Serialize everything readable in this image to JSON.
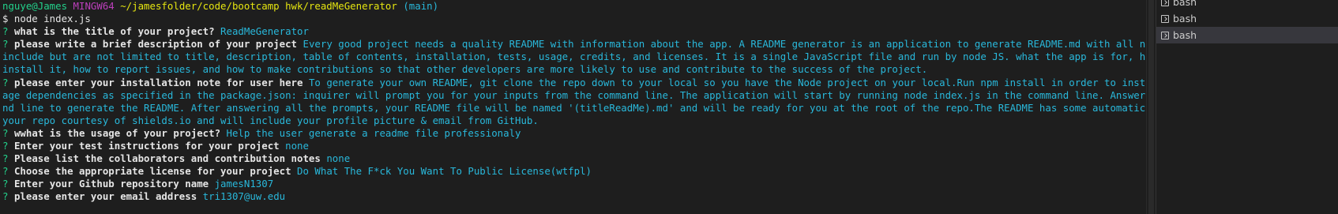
{
  "prompt": {
    "user": "nguye@James",
    "host": "MINGW64",
    "path": "~/jamesfolder/code/bootcamp hwk/readMeGenerator",
    "branch": "(main)",
    "command": "$ node index.js"
  },
  "qa": {
    "q1": "what is the title of your project?",
    "a1": "ReadMeGenerator",
    "q2": "please write a brief description of your project",
    "a2_l1": "Every good project needs a quality README with information about the app. A README generator is an application to generate README.md with all necessary components which",
    "a2_l2": "include but are not limited to title, description, table of contents, installation, tests, usage, credits, and licenses. It is a single JavaScript file and run by node JS. what the app is for, how to use the app, how to",
    "a2_l3": "install it, how to report issues, and how to make contributions so that other developers are more likely to use and contribute to the success of the project.",
    "q3": "please enter your installation note for user here",
    "a3_l1": "To generate your own README, git clone the repo down to your local so you have the Node project on your local.Run npm install in order to install the following npm pack",
    "a3_l2": "age dependencies as specified in the package.json: inquirer will prompt you for your inputs from the command line. The application will start by running node index.js in the command line. Answer the prompts in your comma",
    "a3_l3": "nd line to generate the README. After answering all the prompts, your README file will be named '(titleReadMe).md' and will be ready for you at the root of the repo.The README has some automatically generated badges for",
    "a3_l4": "your repo courtesy of shields.io and will include your profile picture & email from GitHub.",
    "q4": "wwhat is the usage of your project?",
    "a4": "Help the user generate a readme file professionaly",
    "q5": "Enter your test instructions for your project",
    "a5": "none",
    "q6": "Please list the collaborators and contribution notes",
    "a6": "none",
    "q7": "Choose the appropriate license for your project",
    "a7": "Do What The F*ck You Want To Public License(wtfpl)",
    "q8": "Enter your Github repository name",
    "a8": "jamesN1307",
    "q9": "please enter your email address",
    "a9": "tri1307@uw.edu"
  },
  "q_mark": "?",
  "terminals": [
    "bash",
    "bash",
    "bash"
  ],
  "active_terminal": 2,
  "colors": {
    "background": "#1e1e1e",
    "question_mark": "#23d18b",
    "answer": "#29b8db",
    "host": "#bc3fbc",
    "path": "#e5e510"
  },
  "icons": [
    "terminal-icon"
  ]
}
